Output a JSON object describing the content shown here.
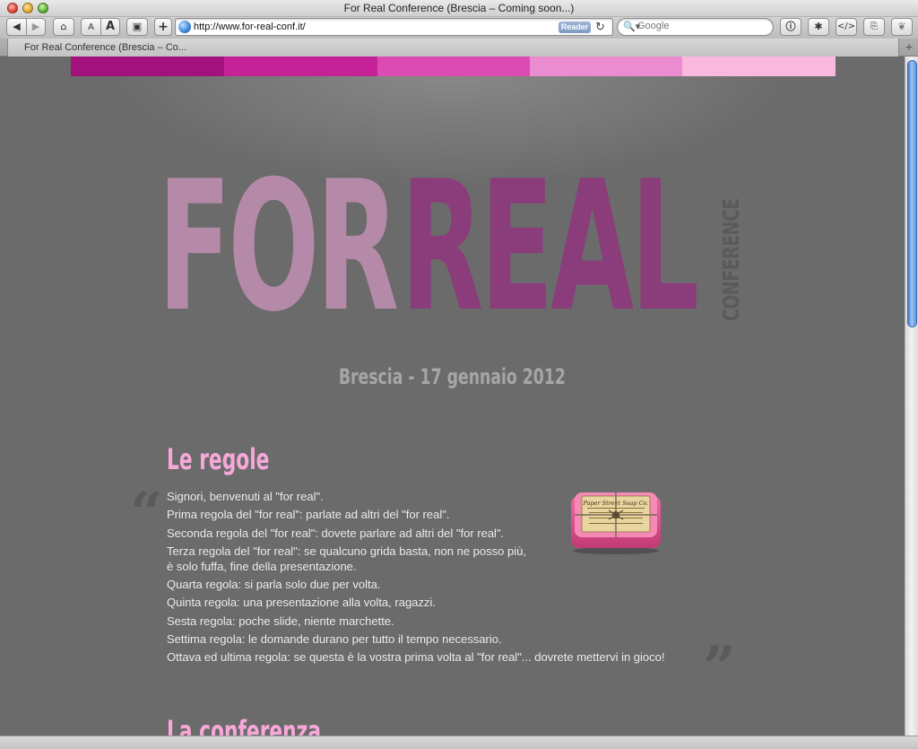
{
  "browser": {
    "window_title": "For Real Conference (Brescia – Coming soon...)",
    "url": "http://www.for-real-conf.it/",
    "reader_label": "Reader",
    "search_placeholder": "Google",
    "tab_title": "For Real Conference (Brescia – Co...",
    "text_small_label": "A",
    "text_large_label": "A",
    "add_bookmark_label": "+",
    "toolbar_icons": [
      "back-icon",
      "forward-icon",
      "home-icon",
      "text-smaller-icon",
      "text-larger-icon",
      "screenshot-icon",
      "add-bookmark-icon",
      "globe-icon",
      "reload-icon",
      "search-icon",
      "info-icon",
      "bug-icon",
      "code-icon",
      "validate-icon",
      "leaf-icon",
      "new-tab-icon"
    ]
  },
  "page": {
    "stripe_colors": [
      "#a3117d",
      "#c62297",
      "#dc4bb1",
      "#ea8ccf",
      "#f9b9df"
    ],
    "logo": {
      "word1": "FOR",
      "word2": "REAL",
      "vertical": "CONFERENCE"
    },
    "date_line": "Brescia - 17 gennaio 2012",
    "rules_title": "Le regole",
    "rules": [
      "Signori, benvenuti al \"for real\".",
      "Prima regola del \"for real\": parlate ad altri del \"for real\".",
      "Seconda regola del \"for real\": dovete parlare ad altri del \"for real\".",
      "Terza regola del \"for real\": se qualcuno grida basta, non ne posso più, è solo fuffa, fine della presentazione.",
      "Quarta regola: si parla solo due per volta.",
      "Quinta regola: una presentazione alla volta, ragazzi.",
      "Sesta regola: poche slide, niente marchette.",
      "Settima regola: le domande durano per tutto il tempo necessario.",
      "Ottava ed ultima regola: se questa è la vostra prima volta al \"for real\"... dovrete mettervi in gioco!"
    ],
    "quote_open": "“",
    "quote_close": "”",
    "soap_label": "Paper Street Soap Co.",
    "conference_title": "La conferenza"
  },
  "colors": {
    "background": "#6b6b6b",
    "logo_for": "#b58aa8",
    "logo_real": "#8b3c7b",
    "heading_pink": "#f7a8d9",
    "body_text": "#efefef"
  }
}
